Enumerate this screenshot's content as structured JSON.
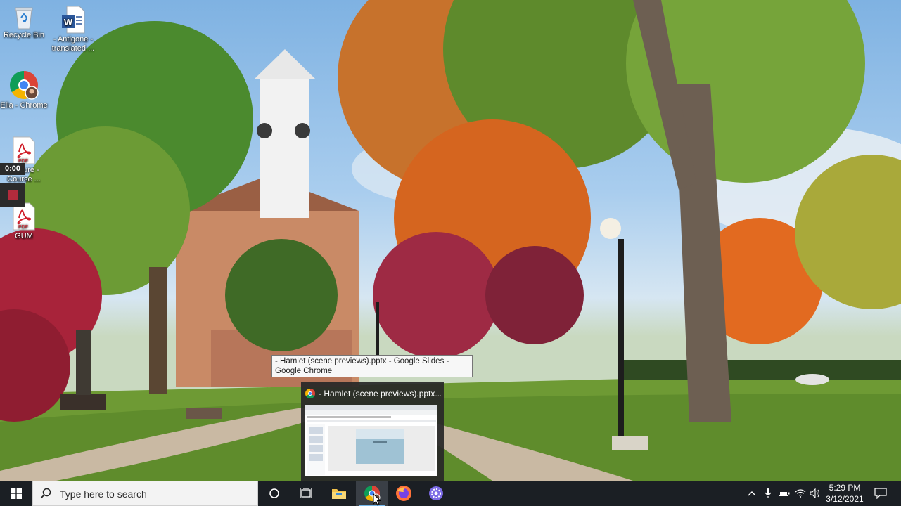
{
  "desktop": {
    "icons": [
      {
        "label": "Recycle Bin",
        "icon": "recycle-bin-icon"
      },
      {
        "label": "- Antigone - translated ...",
        "icon": "word-document-icon"
      },
      {
        "label": "Ella - Chrome",
        "icon": "chrome-profile-icon"
      },
      {
        "label": "Lecture - Course ...",
        "icon": "pdf-document-icon"
      },
      {
        "label": "GUM",
        "icon": "pdf-document-icon"
      }
    ],
    "icon_badge_pdf": "PDF",
    "recorder_timer": "0:00"
  },
  "tooltip": {
    "text": "- Hamlet (scene previews).pptx - Google Slides - Google Chrome"
  },
  "thumbnail": {
    "title": "- Hamlet (scene previews).pptx..."
  },
  "taskbar": {
    "search_placeholder": "Type here to search",
    "apps": [
      "cortana-icon",
      "task-view-icon",
      "file-explorer-icon",
      "chrome-icon",
      "firefox-icon",
      "app-icon"
    ],
    "active_app": "chrome-icon",
    "clock": {
      "time": "5:29 PM",
      "date": "3/12/2021"
    },
    "colors": {
      "bar": "#1b1f24",
      "accent": "#76b9ed"
    }
  }
}
